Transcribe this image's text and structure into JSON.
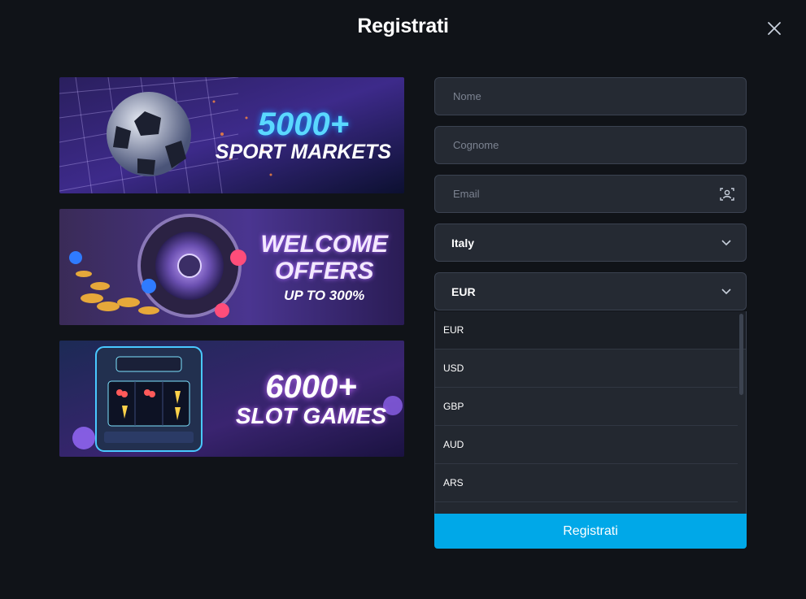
{
  "modal": {
    "title": "Registrati"
  },
  "banners": [
    {
      "line1": "5000+",
      "line2": "SPORT MARKETS",
      "line3": ""
    },
    {
      "line1": "WELCOME",
      "line2": "OFFERS",
      "line3": "UP TO 300%"
    },
    {
      "line1": "6000+",
      "line2": "SLOT GAMES",
      "line3": ""
    }
  ],
  "form": {
    "first_name_placeholder": "Nome",
    "last_name_placeholder": "Cognome",
    "email_placeholder": "Email",
    "country_value": "Italy",
    "currency_value": "EUR",
    "currency_options": [
      "EUR",
      "USD",
      "GBP",
      "AUD",
      "ARS"
    ],
    "submit_label": "Registrati"
  },
  "colors": {
    "background": "#101318",
    "field_bg": "#252a33",
    "accent": "#00a8e8"
  }
}
